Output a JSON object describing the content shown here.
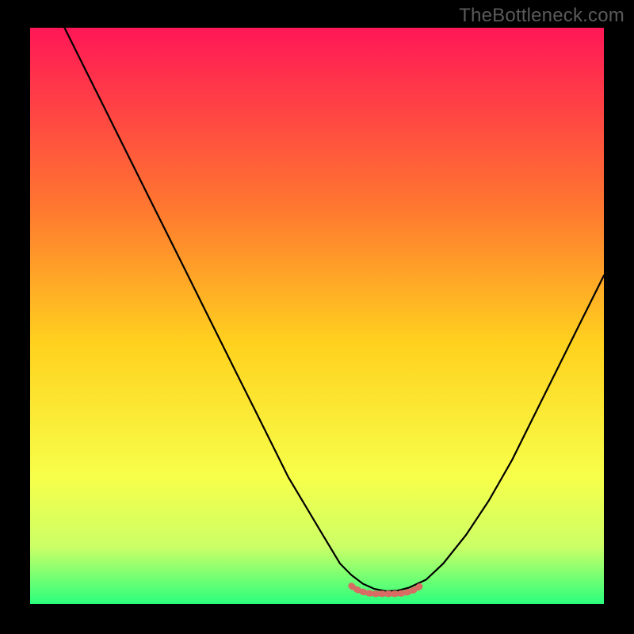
{
  "watermark": "TheBottleneck.com",
  "colors": {
    "background": "#000000",
    "watermark_text": "#5a5a5a",
    "curve_stroke": "#000000",
    "baseline_marker": "#d86b63",
    "gradient_top": "#ff1756",
    "gradient_upper_mid": "#ff7a2f",
    "gradient_mid": "#ffd21e",
    "gradient_lower_mid": "#f7ff4a",
    "gradient_low": "#ccff66",
    "gradient_bottom": "#2bff7d"
  },
  "chart_data": {
    "type": "line",
    "title": "",
    "xlabel": "",
    "ylabel": "",
    "xlim": [
      0,
      100
    ],
    "ylim": [
      0,
      100
    ],
    "series": [
      {
        "name": "bottleneck-curve",
        "x": [
          6,
          8,
          10,
          12,
          15,
          18,
          21,
          24,
          27,
          30,
          33,
          36,
          39,
          42,
          45,
          48,
          51,
          54,
          56,
          58,
          60,
          62,
          64,
          66,
          69,
          72,
          76,
          80,
          84,
          88,
          92,
          96,
          100
        ],
        "values": [
          100,
          96,
          92,
          88,
          82,
          76,
          70,
          64,
          58,
          52,
          46,
          40,
          34,
          28,
          22,
          17,
          12,
          7,
          5,
          3.5,
          2.6,
          2.2,
          2.3,
          2.8,
          4.2,
          7,
          12,
          18,
          25,
          33,
          41,
          49,
          57
        ]
      }
    ],
    "baseline_marker": {
      "x_start": 56,
      "x_end": 68,
      "y": 2.3
    },
    "grid": false,
    "legend": false
  }
}
